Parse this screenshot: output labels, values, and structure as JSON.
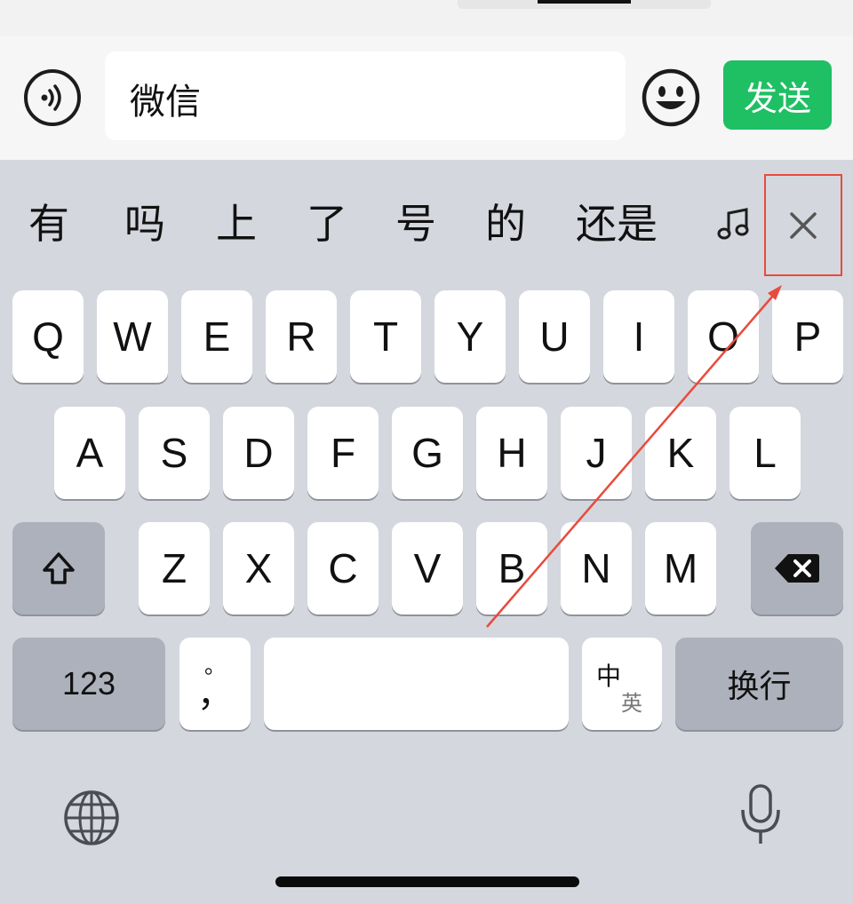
{
  "input_bar": {
    "text_value": "微信",
    "send_label": "发送",
    "voice_icon": "voice-icon",
    "emoji_icon": "emoji-icon"
  },
  "candidates": {
    "items": [
      "有",
      "吗",
      "上",
      "了",
      "号",
      "的",
      "还是"
    ],
    "music_icon": "music-note-icon",
    "close_icon": "close-icon"
  },
  "keyboard": {
    "row1": [
      "Q",
      "W",
      "E",
      "R",
      "T",
      "Y",
      "U",
      "I",
      "O",
      "P"
    ],
    "row2": [
      "A",
      "S",
      "D",
      "F",
      "G",
      "H",
      "J",
      "K",
      "L"
    ],
    "row3": [
      "Z",
      "X",
      "C",
      "V",
      "B",
      "N",
      "M"
    ],
    "shift_icon": "shift-icon",
    "delete_icon": "backspace-icon",
    "numbers_label": "123",
    "punct_top": "。",
    "punct_bottom": "，",
    "space_label": "",
    "lang_top": "中",
    "lang_bottom": "英",
    "return_label": "换行",
    "globe_icon": "globe-icon",
    "mic_icon": "microphone-icon"
  },
  "colors": {
    "send_green": "#1fbf64",
    "highlight_red": "#e84b3c"
  }
}
